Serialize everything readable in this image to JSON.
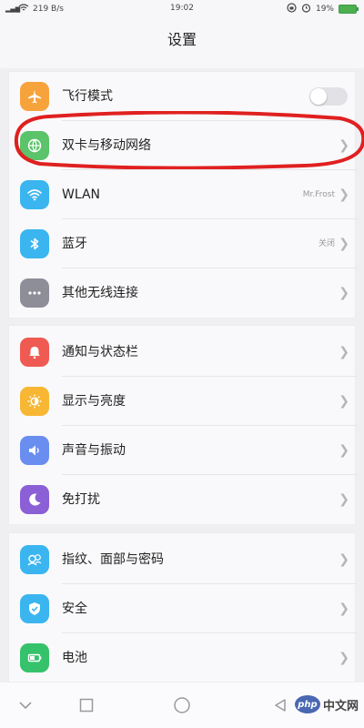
{
  "status_bar": {
    "signal_text": "4G\n4G",
    "speed": "219 B/s",
    "time": "19:02",
    "battery_text": "19%"
  },
  "header": {
    "title": "设置"
  },
  "groups": [
    {
      "items": [
        {
          "label": "飞行模式",
          "icon": "airplane-icon",
          "color": "#f7a33c",
          "control": "toggle",
          "toggle_on": false
        },
        {
          "label": "双卡与移动网络",
          "icon": "globe-icon",
          "color": "#5bc36a",
          "control": "chevron"
        },
        {
          "label": "WLAN",
          "icon": "wifi-icon",
          "color": "#3ab5f0",
          "control": "chevron",
          "value": "Mr.Frost"
        },
        {
          "label": "蓝牙",
          "icon": "bluetooth-icon",
          "color": "#3ab5f0",
          "control": "chevron",
          "value": "关闭"
        },
        {
          "label": "其他无线连接",
          "icon": "more-icon",
          "color": "#8e8e98",
          "control": "chevron"
        }
      ]
    },
    {
      "items": [
        {
          "label": "通知与状态栏",
          "icon": "bell-icon",
          "color": "#ef5a52",
          "control": "chevron"
        },
        {
          "label": "显示与亮度",
          "icon": "brightness-icon",
          "color": "#f7b733",
          "control": "chevron"
        },
        {
          "label": "声音与振动",
          "icon": "speaker-icon",
          "color": "#6a8ef0",
          "control": "chevron"
        },
        {
          "label": "免打扰",
          "icon": "moon-icon",
          "color": "#8b5fd6",
          "control": "chevron"
        }
      ]
    },
    {
      "items": [
        {
          "label": "指纹、面部与密码",
          "icon": "fingerprint-face-icon",
          "color": "#3ab5f0",
          "control": "chevron"
        },
        {
          "label": "安全",
          "icon": "shield-icon",
          "color": "#3ab5f0",
          "control": "chevron"
        },
        {
          "label": "电池",
          "icon": "battery-icon",
          "color": "#36c26b",
          "control": "chevron"
        }
      ]
    }
  ],
  "annotation_color": "#e02020",
  "watermark": {
    "badge": "php",
    "text": "中文网"
  }
}
